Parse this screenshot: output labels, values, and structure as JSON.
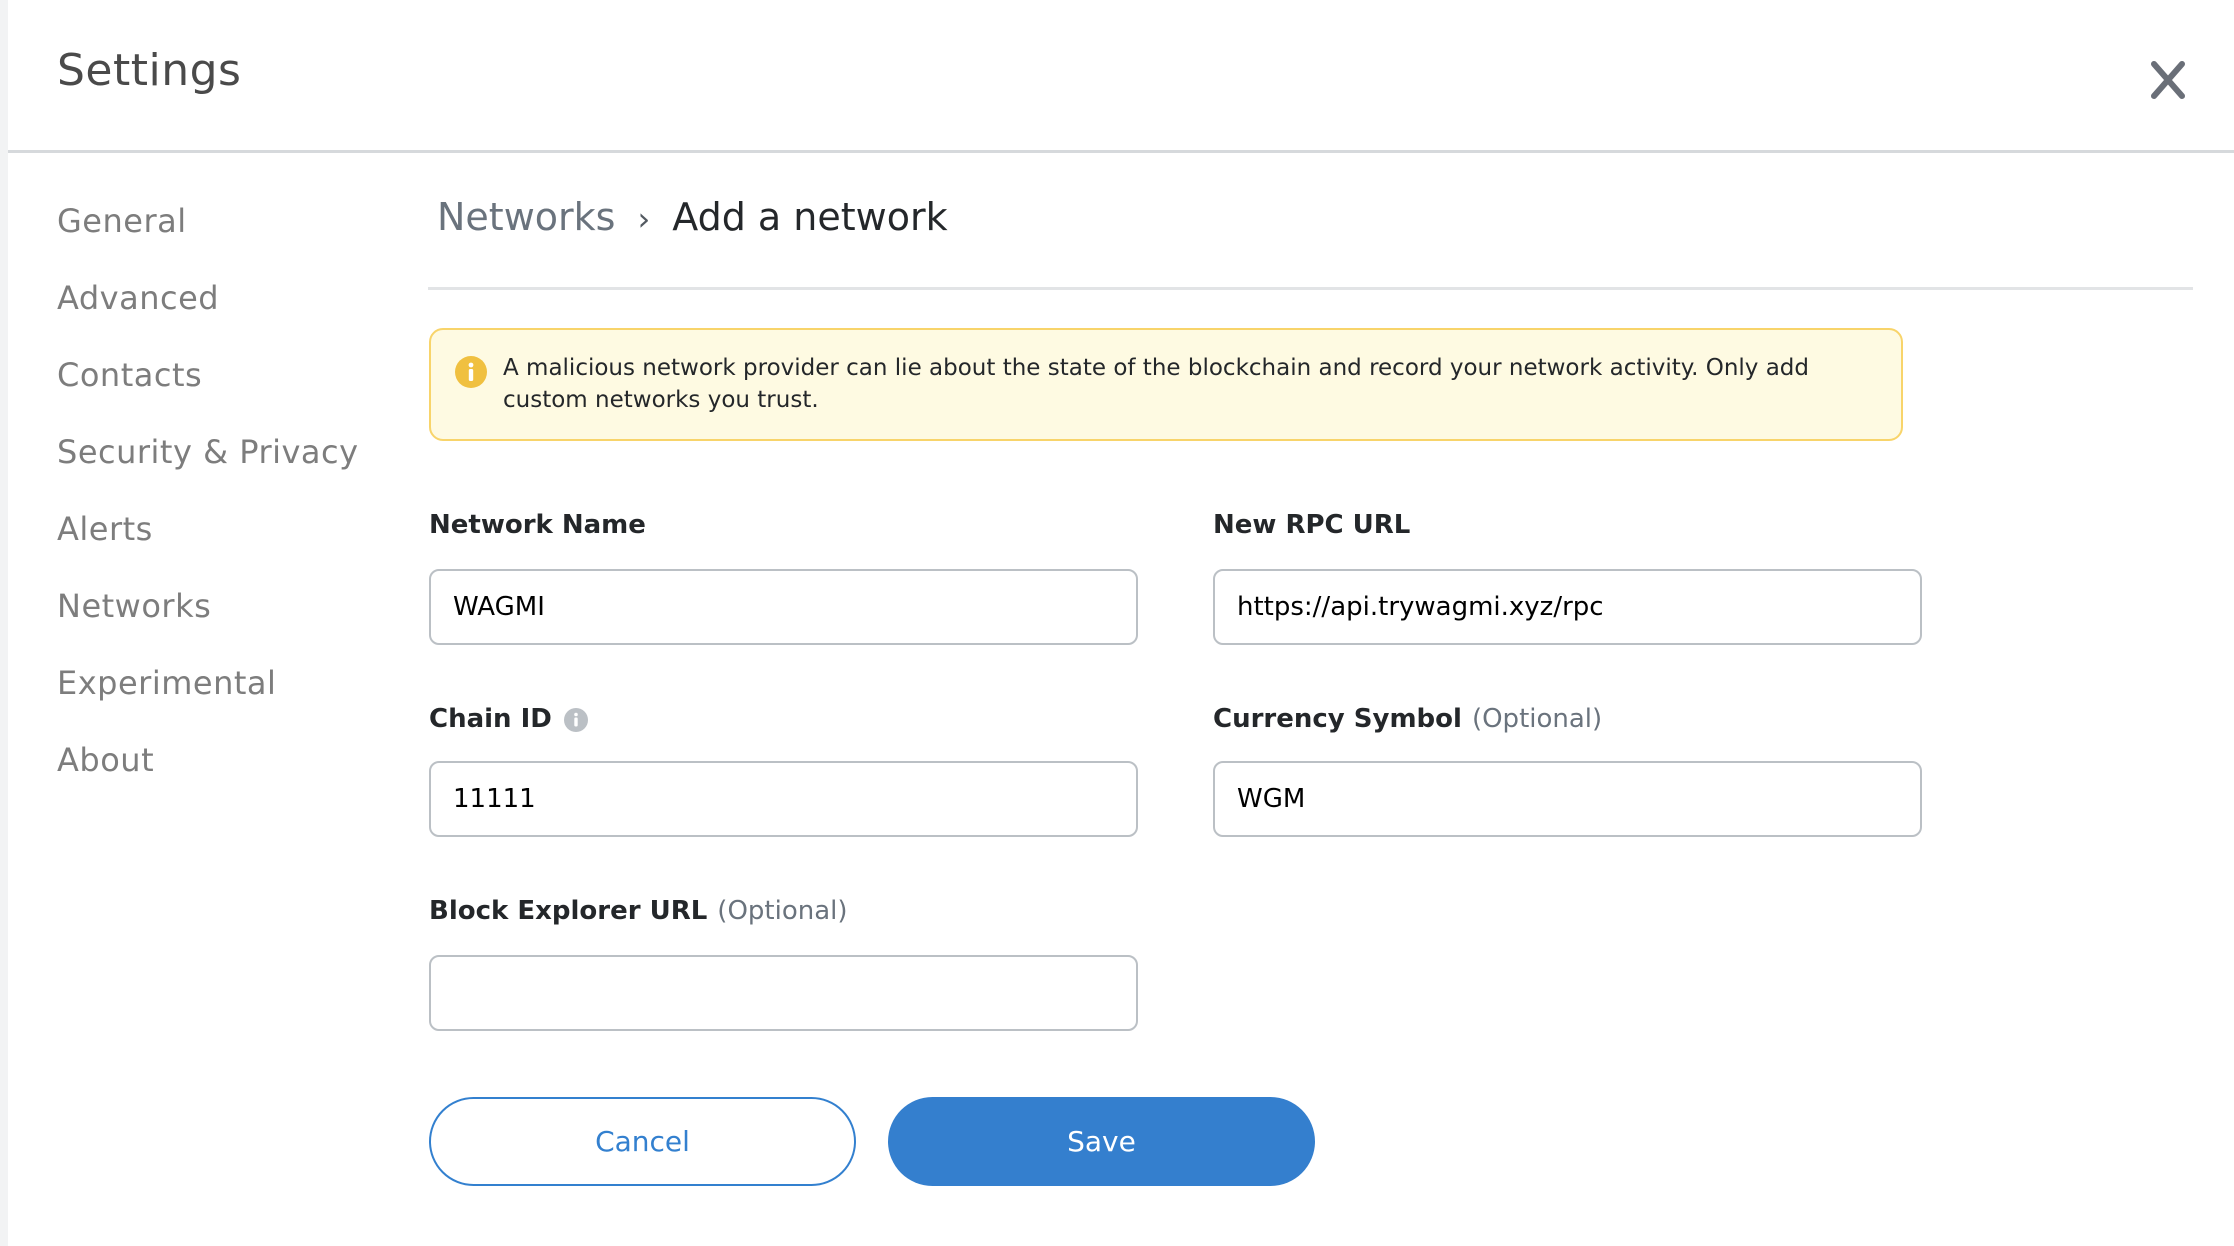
{
  "header": {
    "title": "Settings",
    "close_icon": "close-icon"
  },
  "sidebar": {
    "items": [
      {
        "label": "General"
      },
      {
        "label": "Advanced"
      },
      {
        "label": "Contacts"
      },
      {
        "label": "Security & Privacy"
      },
      {
        "label": "Alerts"
      },
      {
        "label": "Networks"
      },
      {
        "label": "Experimental"
      },
      {
        "label": "About"
      }
    ]
  },
  "breadcrumb": {
    "parent": "Networks",
    "separator": "›",
    "current": "Add a network"
  },
  "warning": {
    "icon": "info-icon",
    "text": "A malicious network provider can lie about the state of the blockchain and record your network activity. Only add custom networks you trust."
  },
  "form": {
    "network_name": {
      "label": "Network Name",
      "value": "WAGMI"
    },
    "rpc_url": {
      "label": "New RPC URL",
      "value": "https://api.trywagmi.xyz/rpc"
    },
    "chain_id": {
      "label": "Chain ID",
      "value": "11111",
      "info_icon": "info-icon"
    },
    "currency_symbol": {
      "label": "Currency Symbol",
      "optional": "(Optional)",
      "value": "WGM"
    },
    "block_explorer": {
      "label": "Block Explorer URL",
      "optional": "(Optional)",
      "value": ""
    }
  },
  "buttons": {
    "cancel": "Cancel",
    "save": "Save"
  },
  "colors": {
    "accent": "#347fce",
    "warning_bg": "#fefae2",
    "warning_border": "#f8d46a",
    "warning_icon": "#f0c040"
  }
}
